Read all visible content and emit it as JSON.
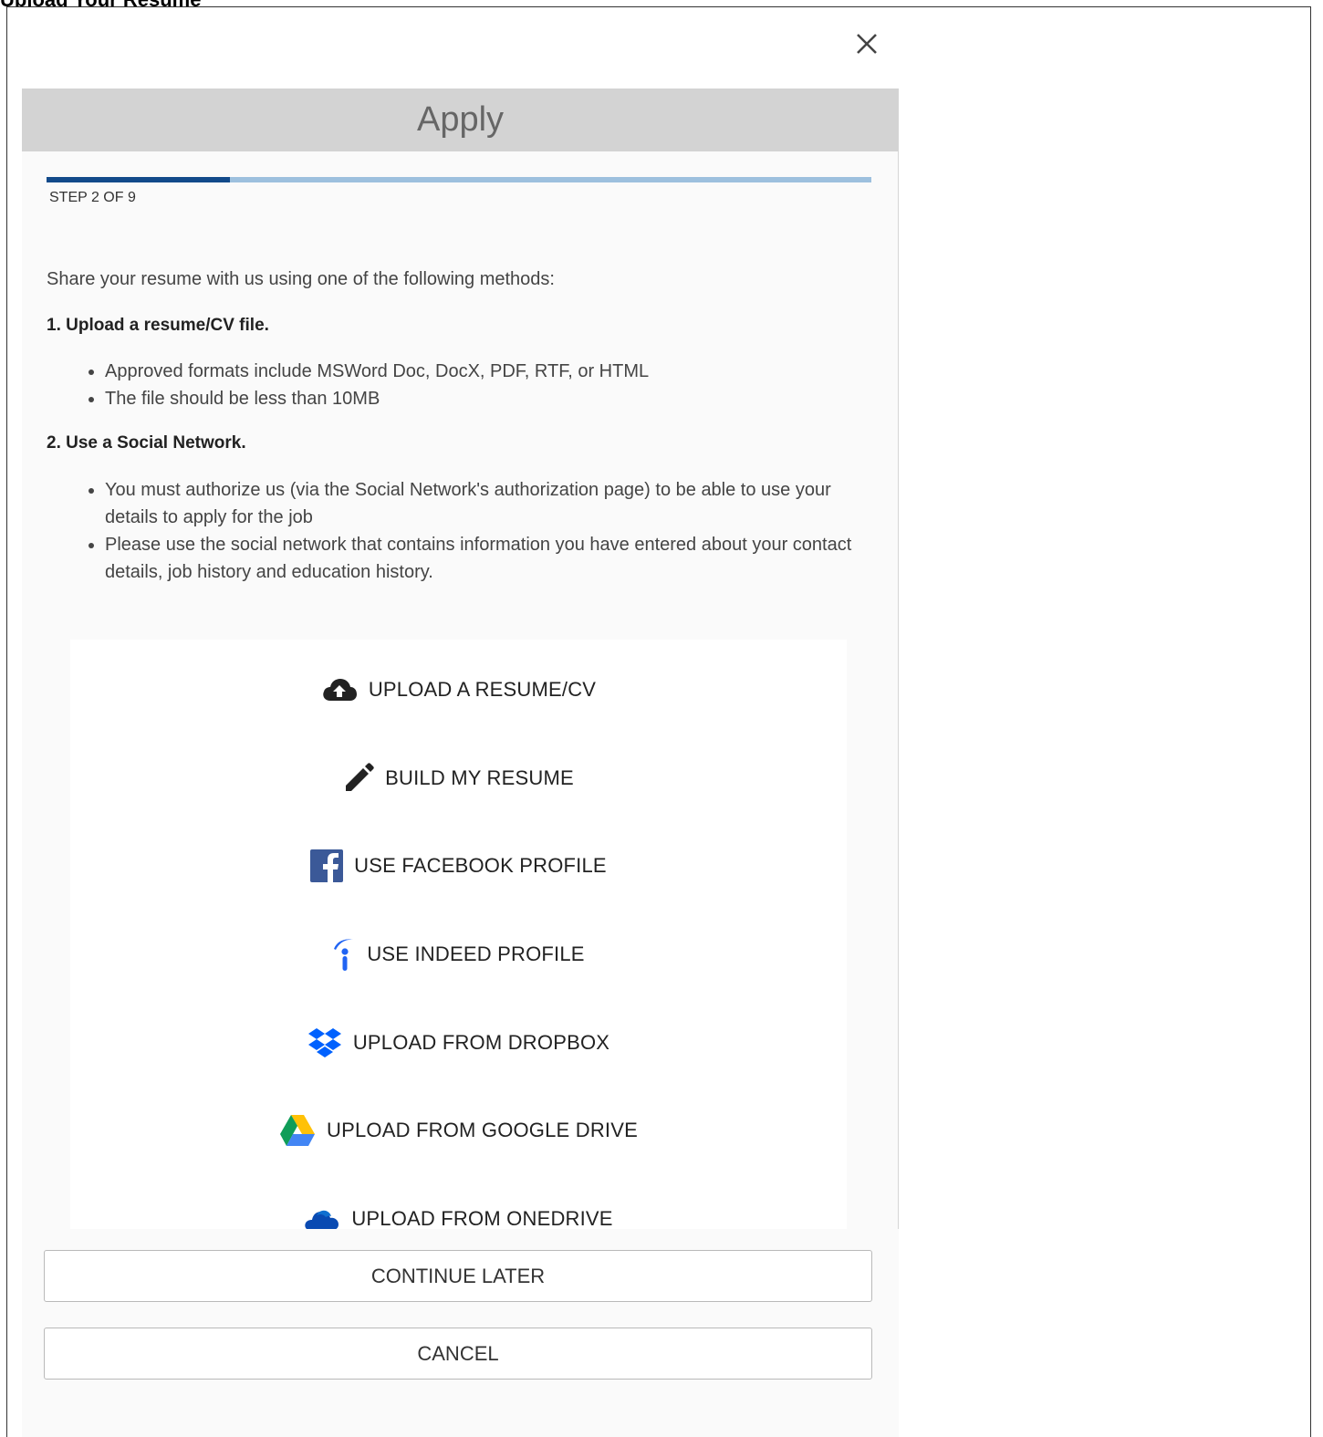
{
  "page": {
    "heading_partial": "Upload Your Resume"
  },
  "modal": {
    "close_icon": "close-icon",
    "title": "Apply",
    "step": {
      "label": "STEP 2 OF 9",
      "current": 2,
      "total": 9
    },
    "intro": "Share your resume with us using one of the following methods:",
    "sections": [
      {
        "heading": "1. Upload a resume/CV file.",
        "bullets": [
          "Approved formats include MSWord Doc, DocX, PDF, RTF, or HTML",
          "The file should be less than 10MB"
        ]
      },
      {
        "heading": "2. Use a Social Network.",
        "bullets": [
          "You must authorize us (via the Social Network's authorization page) to be able to use your details to apply for the job",
          "Please use the social network that contains information you have entered about your contact details, job history and education history."
        ]
      }
    ],
    "options": [
      {
        "label": "UPLOAD A RESUME/CV",
        "icon": "cloud-upload-icon"
      },
      {
        "label": "BUILD MY RESUME",
        "icon": "pencil-icon"
      },
      {
        "label": "USE FACEBOOK PROFILE",
        "icon": "facebook-icon"
      },
      {
        "label": "USE INDEED PROFILE",
        "icon": "indeed-icon"
      },
      {
        "label": "UPLOAD FROM DROPBOX",
        "icon": "dropbox-icon"
      },
      {
        "label": "UPLOAD FROM GOOGLE DRIVE",
        "icon": "google-drive-icon"
      },
      {
        "label": "UPLOAD FROM ONEDRIVE",
        "icon": "onedrive-icon"
      }
    ],
    "footer": {
      "continue_later": "CONTINUE LATER",
      "cancel": "CANCEL"
    }
  },
  "colors": {
    "progress_fill": "#124a8a",
    "progress_track": "#9dc0de",
    "header_bar": "#d3d3d3",
    "facebook": "#3b5998",
    "indeed": "#2164f3",
    "dropbox": "#0061fe",
    "onedrive": "#094ab2"
  }
}
